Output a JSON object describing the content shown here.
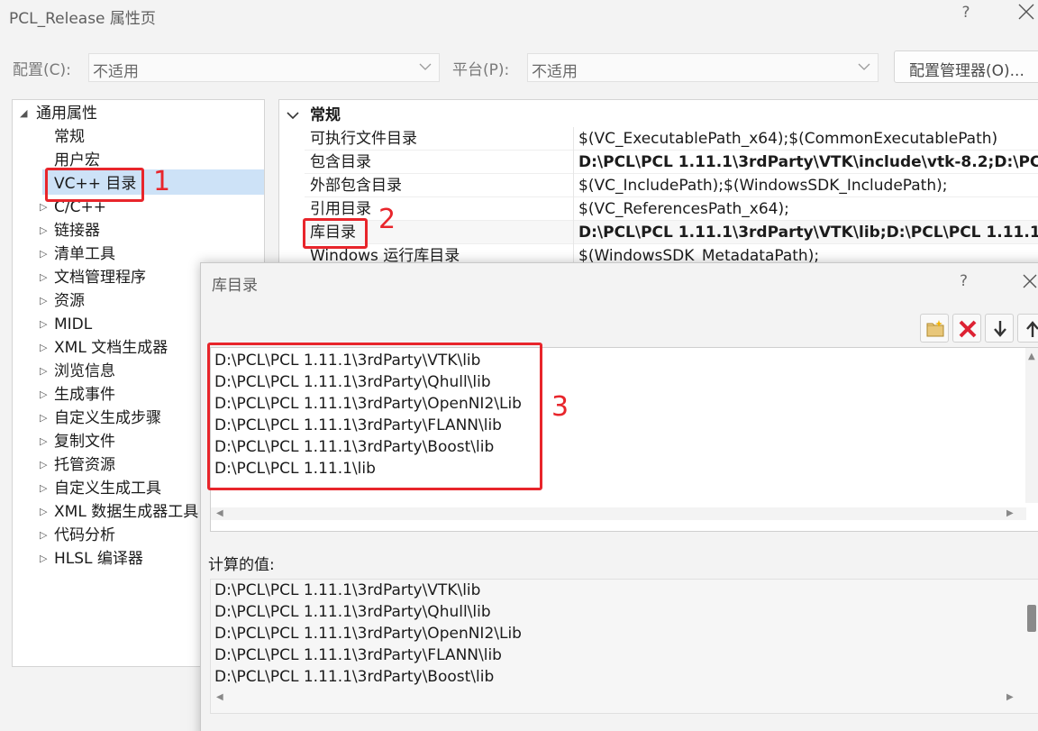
{
  "window": {
    "title": "PCL_Release 属性页",
    "help": "?"
  },
  "config_bar": {
    "config_label": "配置(C):",
    "config_value": "不适用",
    "platform_label": "平台(P):",
    "platform_value": "不适用",
    "manager_button": "配置管理器(O)..."
  },
  "tree": {
    "root": "通用属性",
    "items": [
      {
        "label": "常规",
        "expandable": false
      },
      {
        "label": "用户宏",
        "expandable": false
      },
      {
        "label": "VC++ 目录",
        "expandable": false,
        "selected": true
      },
      {
        "label": "C/C++",
        "expandable": true
      },
      {
        "label": "链接器",
        "expandable": true
      },
      {
        "label": "清单工具",
        "expandable": true
      },
      {
        "label": "文档管理程序",
        "expandable": true
      },
      {
        "label": "资源",
        "expandable": true
      },
      {
        "label": "MIDL",
        "expandable": true
      },
      {
        "label": "XML 文档生成器",
        "expandable": true
      },
      {
        "label": "浏览信息",
        "expandable": true
      },
      {
        "label": "生成事件",
        "expandable": true
      },
      {
        "label": "自定义生成步骤",
        "expandable": true
      },
      {
        "label": "复制文件",
        "expandable": true
      },
      {
        "label": "托管资源",
        "expandable": true
      },
      {
        "label": "自定义生成工具",
        "expandable": true
      },
      {
        "label": "XML 数据生成器工具",
        "expandable": true
      },
      {
        "label": "代码分析",
        "expandable": true
      },
      {
        "label": "HLSL 编译器",
        "expandable": true
      }
    ]
  },
  "grid": {
    "category": "常规",
    "rows": [
      {
        "name": "可执行文件目录",
        "value": "$(VC_ExecutablePath_x64);$(CommonExecutablePath)",
        "bold": false
      },
      {
        "name": "包含目录",
        "value": "D:\\PCL\\PCL 1.11.1\\3rdParty\\VTK\\include\\vtk-8.2;D:\\PCL\\",
        "bold": true
      },
      {
        "name": "外部包含目录",
        "value": "$(VC_IncludePath);$(WindowsSDK_IncludePath);",
        "bold": false
      },
      {
        "name": "引用目录",
        "value": "$(VC_ReferencesPath_x64);",
        "bold": false
      },
      {
        "name": "库目录",
        "value": "D:\\PCL\\PCL 1.11.1\\3rdParty\\VTK\\lib;D:\\PCL\\PCL 1.11.1\\3r",
        "bold": true
      },
      {
        "name": "Windows 运行库目录",
        "value": "$(WindowsSDK_MetadataPath);",
        "bold": false
      }
    ]
  },
  "dialog": {
    "title": "库目录",
    "help": "?",
    "tools": [
      "new-folder-icon",
      "delete-icon",
      "move-down-icon",
      "move-up-icon"
    ],
    "entries": [
      "D:\\PCL\\PCL 1.11.1\\3rdParty\\VTK\\lib",
      "D:\\PCL\\PCL 1.11.1\\3rdParty\\Qhull\\lib",
      "D:\\PCL\\PCL 1.11.1\\3rdParty\\OpenNI2\\Lib",
      "D:\\PCL\\PCL 1.11.1\\3rdParty\\FLANN\\lib",
      "D:\\PCL\\PCL 1.11.1\\3rdParty\\Boost\\lib",
      "D:\\PCL\\PCL 1.11.1\\lib"
    ],
    "computed_label": "计算的值:",
    "computed": [
      "D:\\PCL\\PCL 1.11.1\\3rdParty\\VTK\\lib",
      "D:\\PCL\\PCL 1.11.1\\3rdParty\\Qhull\\lib",
      "D:\\PCL\\PCL 1.11.1\\3rdParty\\OpenNI2\\Lib",
      "D:\\PCL\\PCL 1.11.1\\3rdParty\\FLANN\\lib",
      "D:\\PCL\\PCL 1.11.1\\3rdParty\\Boost\\lib"
    ]
  },
  "annotations": {
    "num1": "1",
    "num2": "2",
    "num3": "3",
    "color": "#e8252b"
  },
  "colors": {
    "selection": "#cde2f7",
    "background": "#f3f3f3"
  }
}
